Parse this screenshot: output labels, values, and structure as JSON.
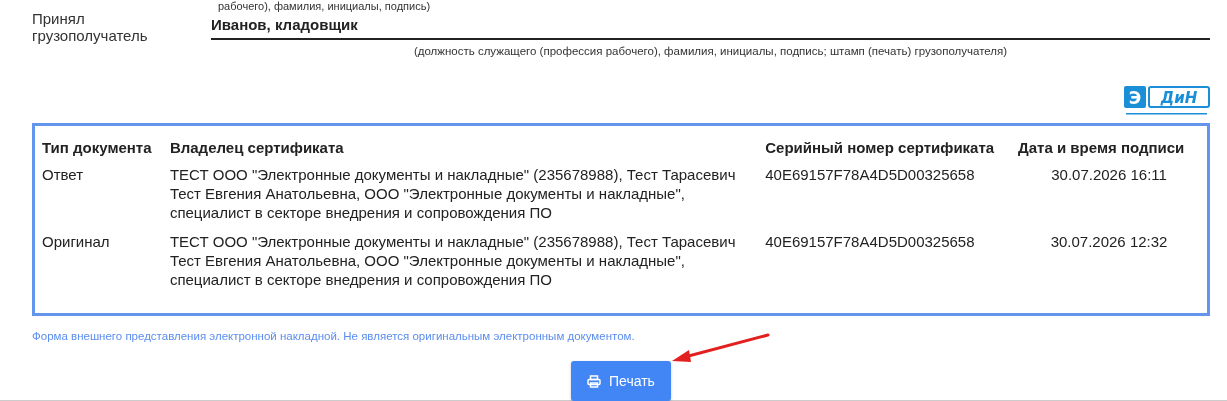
{
  "top_caption_cut": "рабочего), фамилия, инициалы, подпись)",
  "receiver": {
    "label": "Принял грузополучатель",
    "value": "Иванов, кладовщик",
    "caption": "(должность служащего (профессия рабочего), фамилия, инициалы, подпись; штамп (печать) грузополучателя)"
  },
  "logo": {
    "letter": "Э",
    "name": "ДиН"
  },
  "signatures": {
    "columns": [
      "Тип документа",
      "Владелец сертификата",
      "Серийный номер сертификата",
      "Дата и время подписи"
    ],
    "rows": [
      [
        "Ответ",
        "ТЕСТ ООО \"Электронные документы и накладные\" (235678988), Тест Тарасевич Тест Евгения Анатольевна, ООО \"Электронные документы и накладные\", специалист в секторе внедрения и сопровождения ПО",
        "40E69157F78A4D5D00325658",
        "30.07.2026 16:11"
      ],
      [
        "Оригинал",
        "ТЕСТ ООО \"Электронные документы и накладные\" (235678988), Тест Тарасевич Тест Евгения Анатольевна, ООО \"Электронные документы и накладные\", специалист в секторе внедрения и сопровождения ПО",
        "40E69157F78A4D5D00325658",
        "30.07.2026 12:32"
      ]
    ]
  },
  "footnote": "Форма внешнего представления электронной накладной. Не является оригинальным электронным документом.",
  "print_button": {
    "label": "Печать"
  }
}
